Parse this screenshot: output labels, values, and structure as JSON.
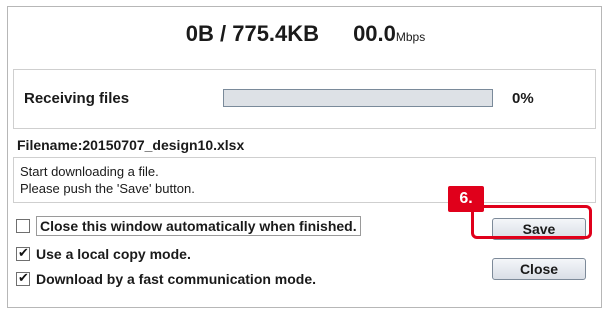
{
  "transfer": {
    "received": "0B / 775.4KB",
    "speed": "00.0",
    "speed_unit": "Mbps"
  },
  "receiving": {
    "label": "Receiving files",
    "progress_fraction": 0.0,
    "percent_text": "0%"
  },
  "file": {
    "filename_text": "Filename:20150707_design10.xlsx"
  },
  "messages": {
    "line1": "Start downloading a file.",
    "line2": "Please push the 'Save' button."
  },
  "options": [
    {
      "label": "Close this window automatically when finished.",
      "checked": false
    },
    {
      "label": "Use a local copy mode.",
      "checked": true
    },
    {
      "label": "Download by a fast communication mode.",
      "checked": true
    }
  ],
  "buttons": {
    "save_label": "Save",
    "close_label": "Close"
  },
  "annotation": {
    "step_label": "6.",
    "color": "#e0001b"
  }
}
